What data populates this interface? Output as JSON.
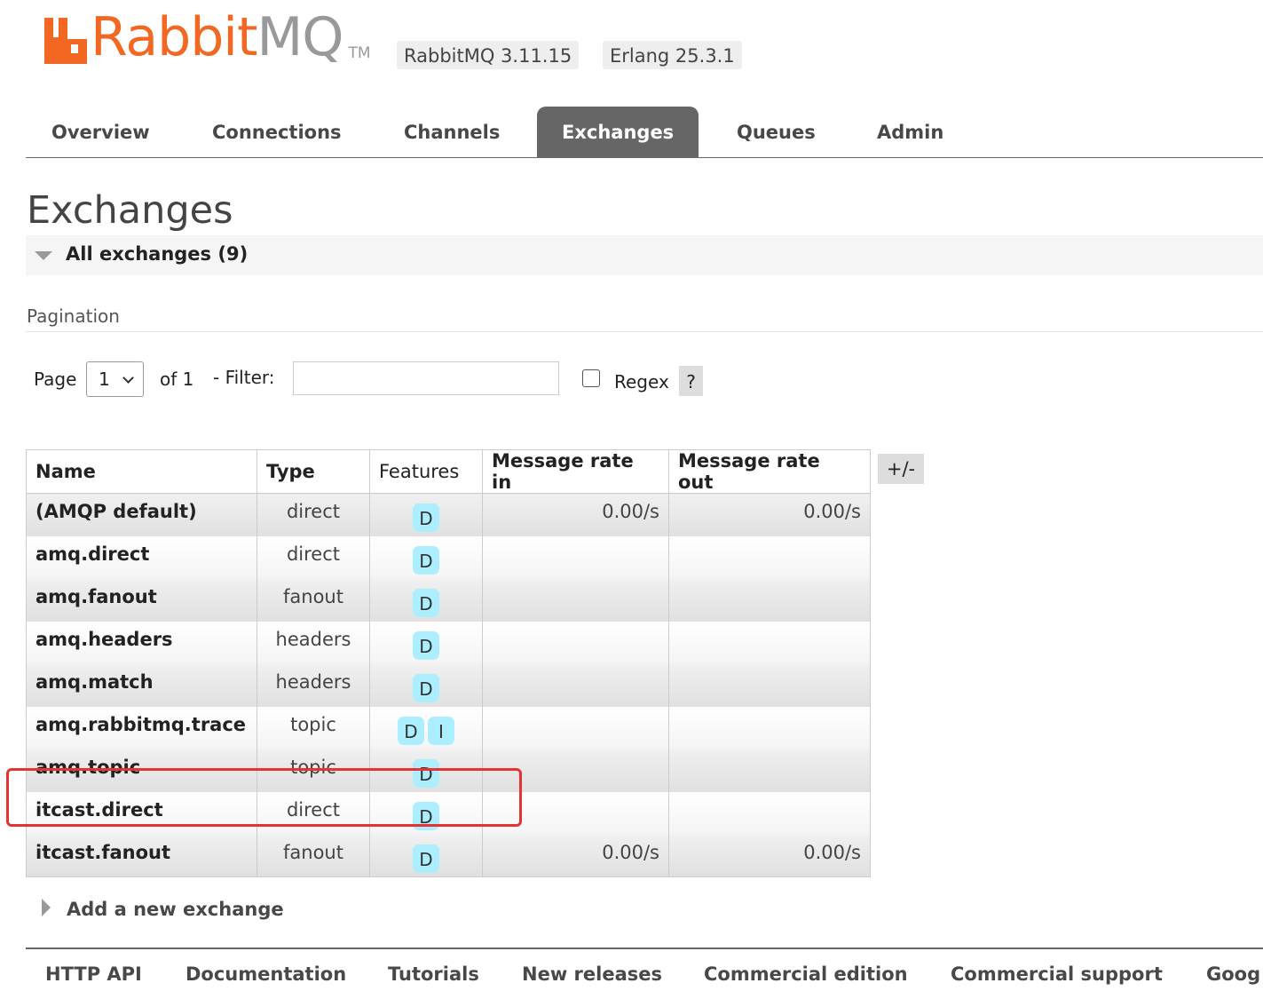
{
  "header": {
    "logo_text_a": "Rabbit",
    "logo_text_b": "MQ",
    "logo_tm": "TM",
    "version": "RabbitMQ 3.11.15",
    "erlang": "Erlang 25.3.1"
  },
  "nav": [
    "Overview",
    "Connections",
    "Channels",
    "Exchanges",
    "Queues",
    "Admin"
  ],
  "nav_active": "Exchanges",
  "page_title": "Exchanges",
  "section_title": "All exchanges (9)",
  "pagination": {
    "heading": "Pagination",
    "page_label": "Page",
    "page_value": "1",
    "of_label": "of 1",
    "filter_label": "- Filter:",
    "filter_value": "",
    "regex_label": "Regex",
    "help": "?"
  },
  "table": {
    "columns": [
      "Name",
      "Type",
      "Features",
      "Message rate in",
      "Message rate out"
    ],
    "toggle": "+/-",
    "rows": [
      {
        "name": "(AMQP default)",
        "type": "direct",
        "features": [
          "D"
        ],
        "rate_in": "0.00/s",
        "rate_out": "0.00/s"
      },
      {
        "name": "amq.direct",
        "type": "direct",
        "features": [
          "D"
        ],
        "rate_in": "",
        "rate_out": ""
      },
      {
        "name": "amq.fanout",
        "type": "fanout",
        "features": [
          "D"
        ],
        "rate_in": "",
        "rate_out": ""
      },
      {
        "name": "amq.headers",
        "type": "headers",
        "features": [
          "D"
        ],
        "rate_in": "",
        "rate_out": ""
      },
      {
        "name": "amq.match",
        "type": "headers",
        "features": [
          "D"
        ],
        "rate_in": "",
        "rate_out": ""
      },
      {
        "name": "amq.rabbitmq.trace",
        "type": "topic",
        "features": [
          "D",
          "I"
        ],
        "rate_in": "",
        "rate_out": ""
      },
      {
        "name": "amq.topic",
        "type": "topic",
        "features": [
          "D"
        ],
        "rate_in": "",
        "rate_out": ""
      },
      {
        "name": "itcast.direct",
        "type": "direct",
        "features": [
          "D"
        ],
        "rate_in": "",
        "rate_out": ""
      },
      {
        "name": "itcast.fanout",
        "type": "fanout",
        "features": [
          "D"
        ],
        "rate_in": "0.00/s",
        "rate_out": "0.00/s"
      }
    ]
  },
  "add_exchange": "Add a new exchange",
  "footer": [
    "HTTP API",
    "Documentation",
    "Tutorials",
    "New releases",
    "Commercial edition",
    "Commercial support",
    "Goog"
  ],
  "colors": {
    "brand": "#f26822",
    "nav_active": "#666666",
    "flag": "#aaeeff",
    "highlight": "#e53333"
  }
}
